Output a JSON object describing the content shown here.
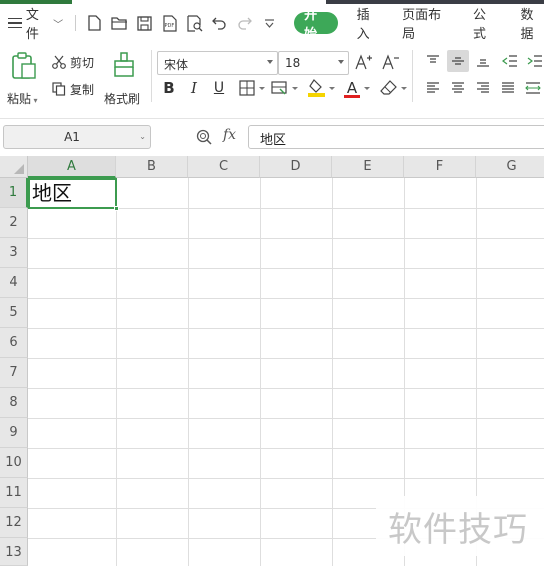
{
  "menu": {
    "file_label": "文件",
    "tabs": [
      "开始",
      "插入",
      "页面布局",
      "公式",
      "数据"
    ],
    "active_tab": "开始",
    "accent_color": "#3da858"
  },
  "quick_access": {
    "icons": [
      "new-file-icon",
      "open-folder-icon",
      "save-icon",
      "export-pdf-icon",
      "print-preview-icon",
      "undo-icon",
      "redo-icon",
      "customize-dropdown-icon"
    ],
    "pdf_glyph": "PDF"
  },
  "ribbon": {
    "paste_label": "粘贴",
    "cut_label": "剪切",
    "copy_label": "复制",
    "format_painter_label": "格式刷",
    "font_name": "宋体",
    "font_size": "18",
    "bold_glyph": "B",
    "italic_glyph": "I",
    "underline_glyph": "U",
    "font_color_glyph": "A",
    "font_color": "#e02020",
    "fill_color": "#f5d400"
  },
  "formula_bar": {
    "name_box": "A1",
    "fx_label": "fx",
    "content": "地区"
  },
  "sheet": {
    "columns": [
      "A",
      "B",
      "C",
      "D",
      "E",
      "F",
      "G"
    ],
    "rows": [
      "1",
      "2",
      "3",
      "4",
      "5",
      "6",
      "7",
      "8",
      "9",
      "10",
      "11",
      "12",
      "13"
    ],
    "selected_cell": "A1",
    "cells": {
      "A1": "地区"
    },
    "selection_color": "#3c9b4f"
  },
  "watermark": "软件技巧"
}
